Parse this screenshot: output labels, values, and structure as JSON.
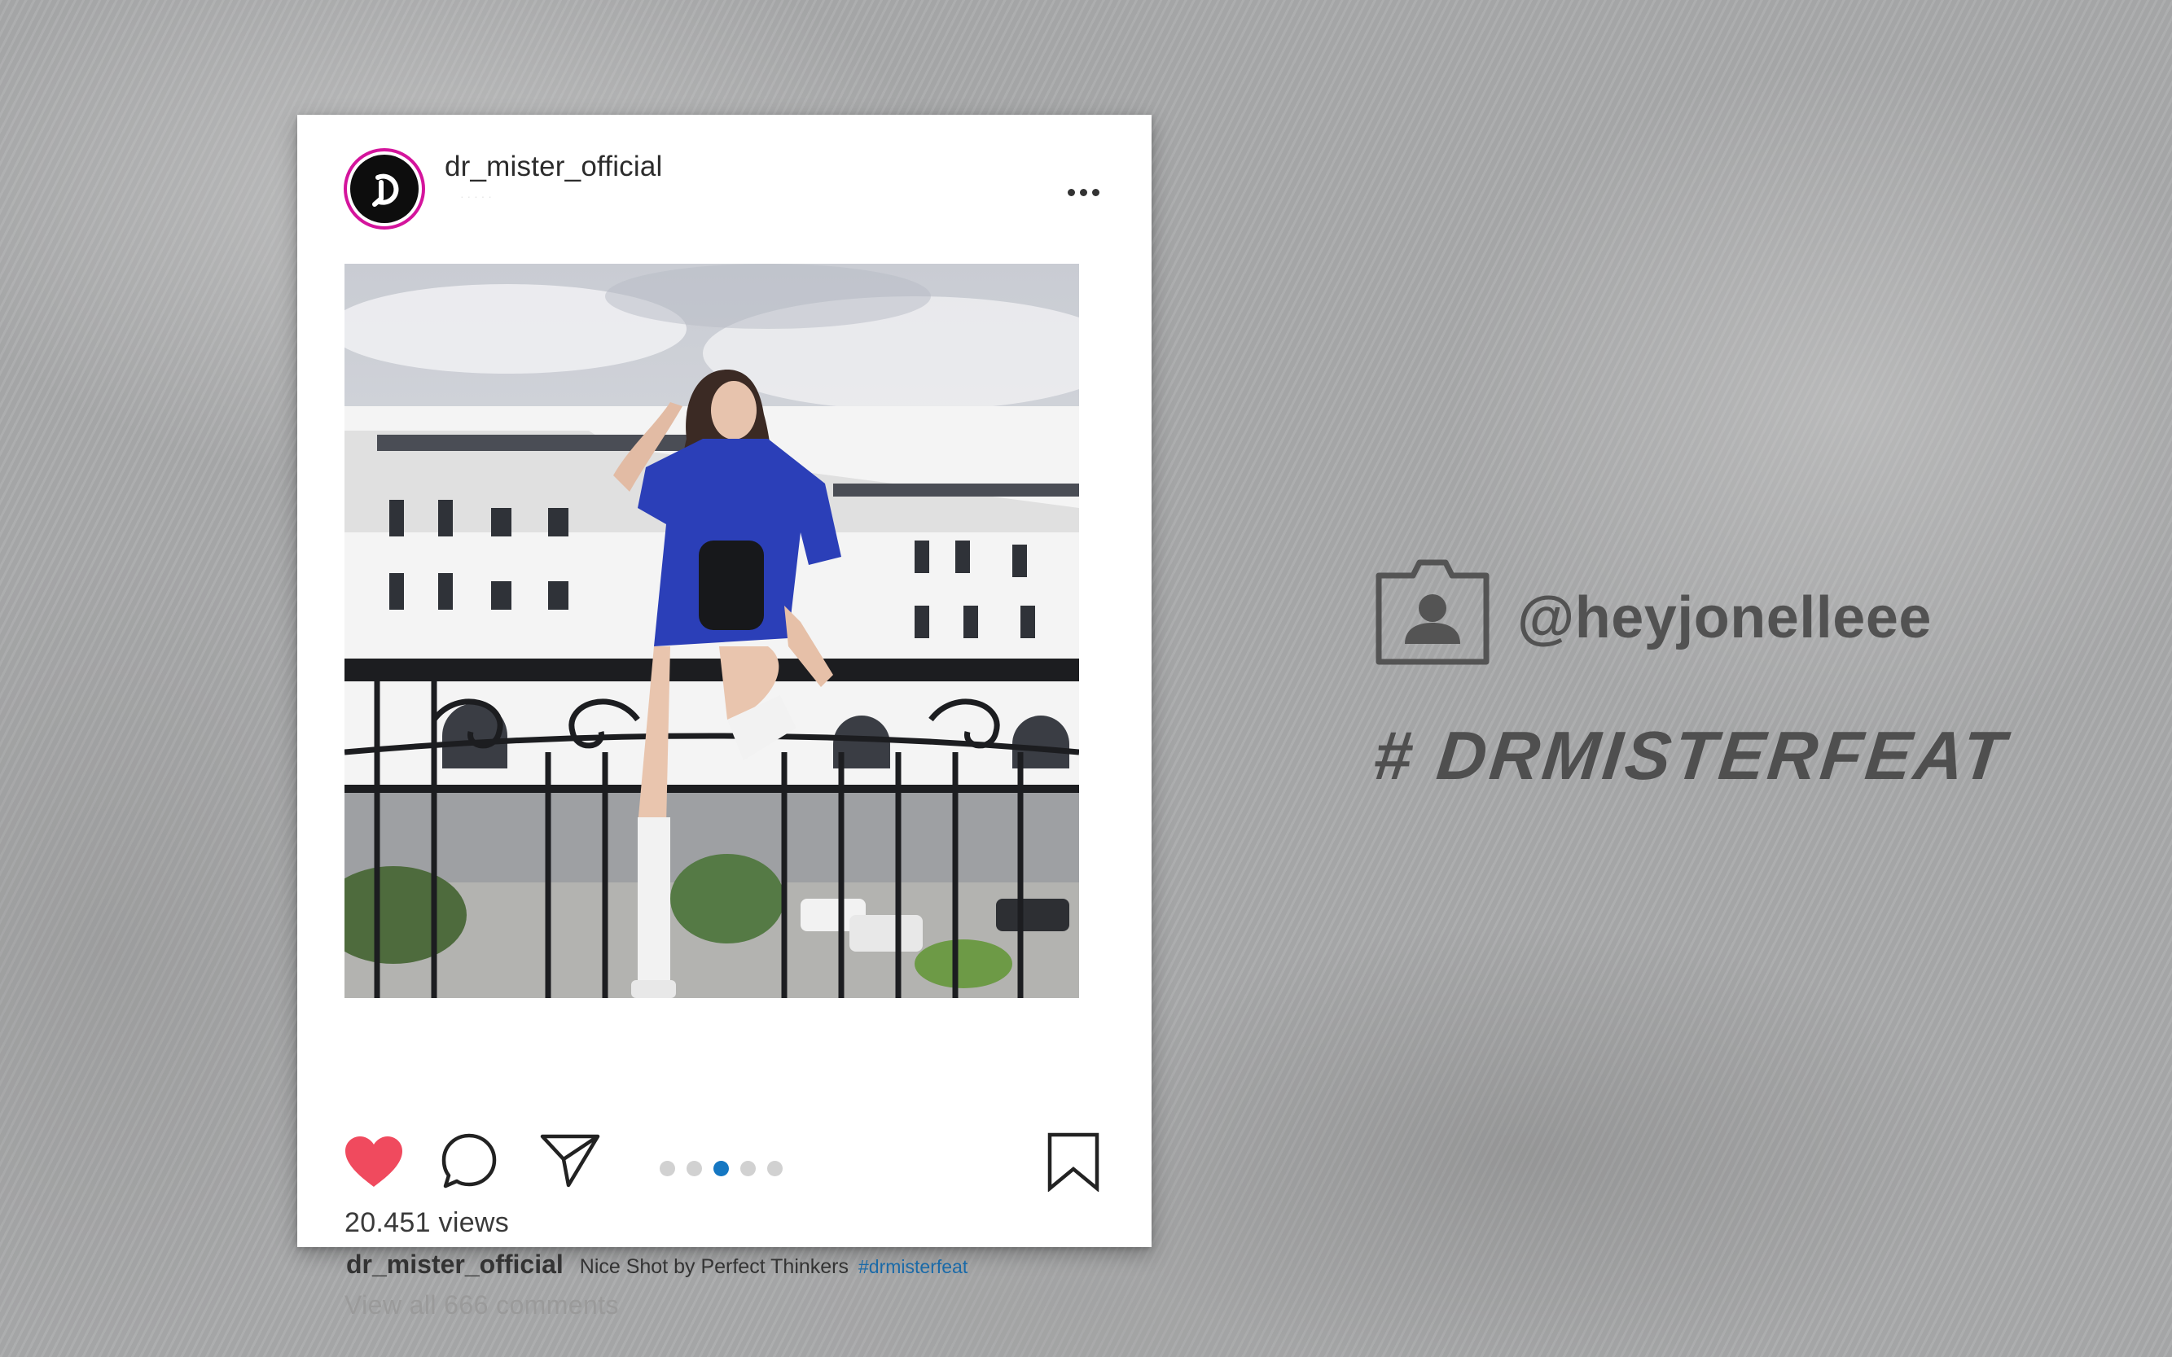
{
  "post": {
    "username": "dr_mister_official",
    "location": "· · · · ·",
    "views": "20.451 views",
    "caption_user": "dr_mister_official",
    "caption_text": "Nice Shot by Perfect Thinkers",
    "caption_hashtag": "#drmisterfeat",
    "view_comments": "View all 666 comments",
    "carousel": {
      "count": 5,
      "active_index": 2
    },
    "liked": true
  },
  "credit": {
    "handle": "@heyjonelleee",
    "hashtag": "# DRMISTERFEAT"
  },
  "icons": [
    "heart-icon",
    "comment-icon",
    "share-icon",
    "bookmark-icon",
    "more-icon",
    "profile-frame-icon"
  ],
  "colors": {
    "avatar_ring": "#d4149c",
    "like_red": "#f04a5e",
    "carousel_active": "#1577c2",
    "hashtag_link": "#1a6aa8",
    "credit_text": "#525252"
  }
}
